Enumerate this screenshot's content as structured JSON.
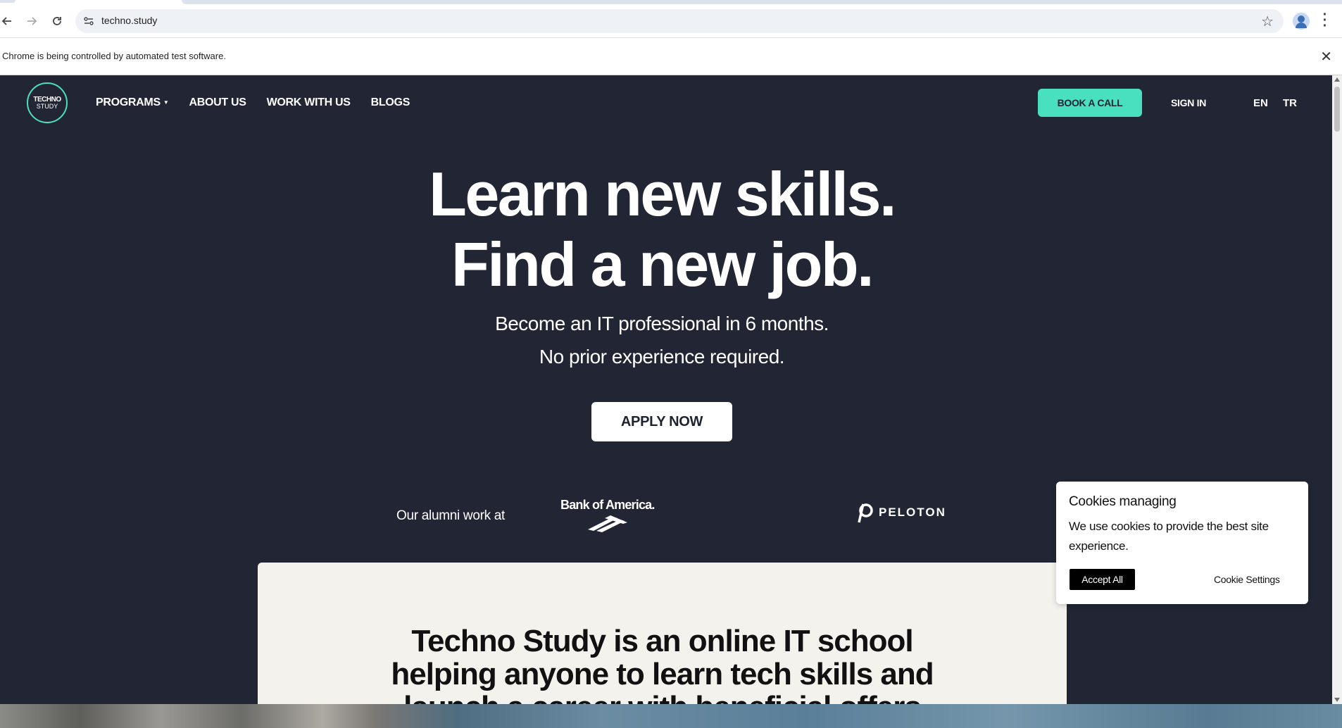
{
  "browser": {
    "url": "techno.study",
    "infobar_message": "Chrome is being controlled by automated test software."
  },
  "site": {
    "logo_line1": "TECHNO",
    "logo_line2": "STUDY",
    "nav": {
      "programs": "PROGRAMS",
      "about": "ABOUT US",
      "work": "WORK WITH US",
      "blogs": "BLOGS"
    },
    "book_call": "BOOK A CALL",
    "sign_in": "SIGN IN",
    "lang_en": "EN",
    "lang_tr": "TR",
    "accent_color": "#49e0bf",
    "background_color": "#222634"
  },
  "hero": {
    "headline_1": "Learn new skills.",
    "headline_2": "Find a new job.",
    "sub_1": "Become an IT professional in 6 months.",
    "sub_2": "No prior experience required.",
    "apply": "APPLY NOW"
  },
  "alumni": {
    "label": "Our alumni work at",
    "company_1": "Bank of America.",
    "company_2": "PELOTON"
  },
  "intro": {
    "line_1": "Techno Study is an online IT school",
    "line_2": "helping anyone to learn tech skills and",
    "line_3": "launch a career with beneficial offers"
  },
  "cookie": {
    "title": "Cookies managing",
    "body": "We use cookies to provide the best site experience.",
    "accept": "Accept All",
    "settings": "Cookie Settings"
  }
}
